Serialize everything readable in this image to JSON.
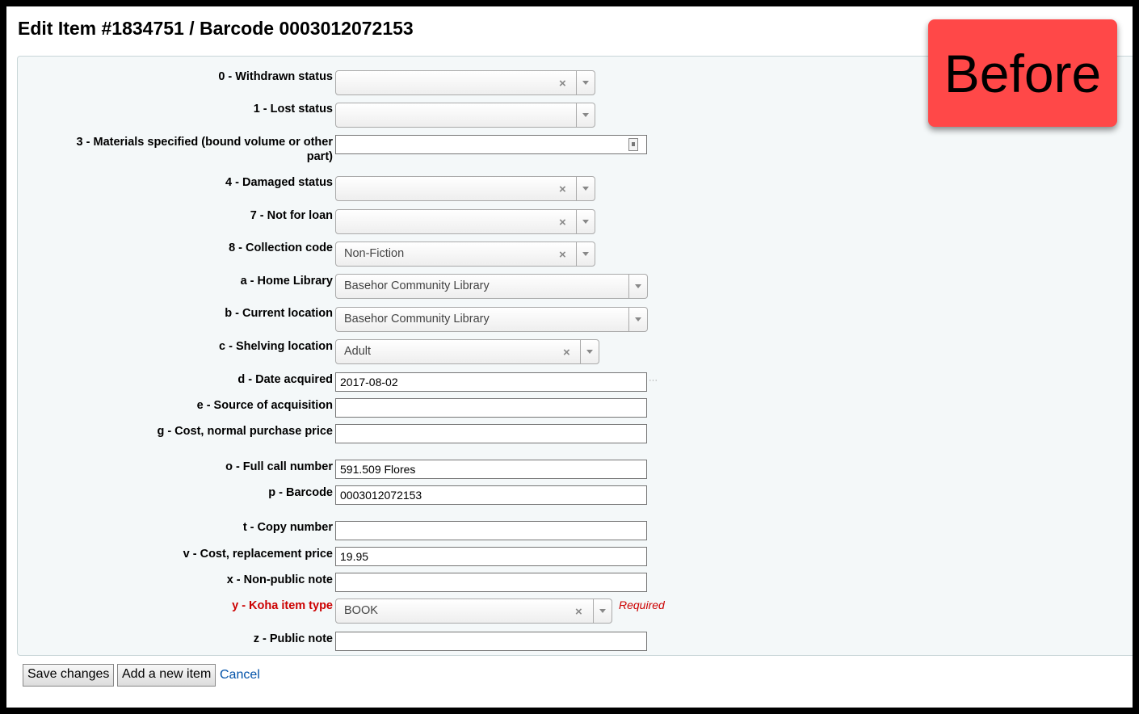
{
  "page": {
    "title": "Edit Item #1834751 / Barcode 0003012072153",
    "badge": "Before"
  },
  "fields": {
    "withdrawn": {
      "label": "0 - Withdrawn status",
      "value": ""
    },
    "lost": {
      "label": "1 - Lost status",
      "value": ""
    },
    "materials": {
      "label_line1": "3 - Materials specified (bound volume or other",
      "label_line2": "part)",
      "value": ""
    },
    "damaged": {
      "label": "4 - Damaged status",
      "value": ""
    },
    "notforloan": {
      "label": "7 - Not for loan",
      "value": ""
    },
    "ccode": {
      "label": "8 - Collection code",
      "value": "Non-Fiction"
    },
    "homelib": {
      "label": "a - Home Library",
      "value": "Basehor Community Library"
    },
    "curloc": {
      "label": "b - Current location",
      "value": "Basehor Community Library"
    },
    "shelving": {
      "label": "c - Shelving location",
      "value": "Adult"
    },
    "dateacq": {
      "label": "d - Date acquired",
      "value": "2017-08-02",
      "dots": "···"
    },
    "source": {
      "label": "e - Source of acquisition",
      "value": ""
    },
    "cost": {
      "label": "g - Cost, normal purchase price",
      "value": ""
    },
    "callnum": {
      "label": "o - Full call number",
      "value": "591.509 Flores"
    },
    "barcode": {
      "label": "p - Barcode",
      "value": "0003012072153"
    },
    "copynum": {
      "label": "t - Copy number",
      "value": ""
    },
    "replcost": {
      "label": "v - Cost, replacement price",
      "value": "19.95"
    },
    "nonpublic": {
      "label": "x - Non-public note",
      "value": ""
    },
    "itemtype": {
      "label": "y - Koha item type",
      "value": "BOOK",
      "required_note": "Required"
    },
    "publicnote": {
      "label": "z - Public note",
      "value": ""
    }
  },
  "icons": {
    "clear": "×",
    "dropdown": "chevron-down-icon",
    "file": "file-icon"
  },
  "actions": {
    "save": "Save changes",
    "add": "Add a new item",
    "cancel": "Cancel"
  },
  "colors": {
    "required": "#cc0000",
    "badge": "#ff4848",
    "link": "#0051a8",
    "panel_bg": "#f4f8f9"
  }
}
